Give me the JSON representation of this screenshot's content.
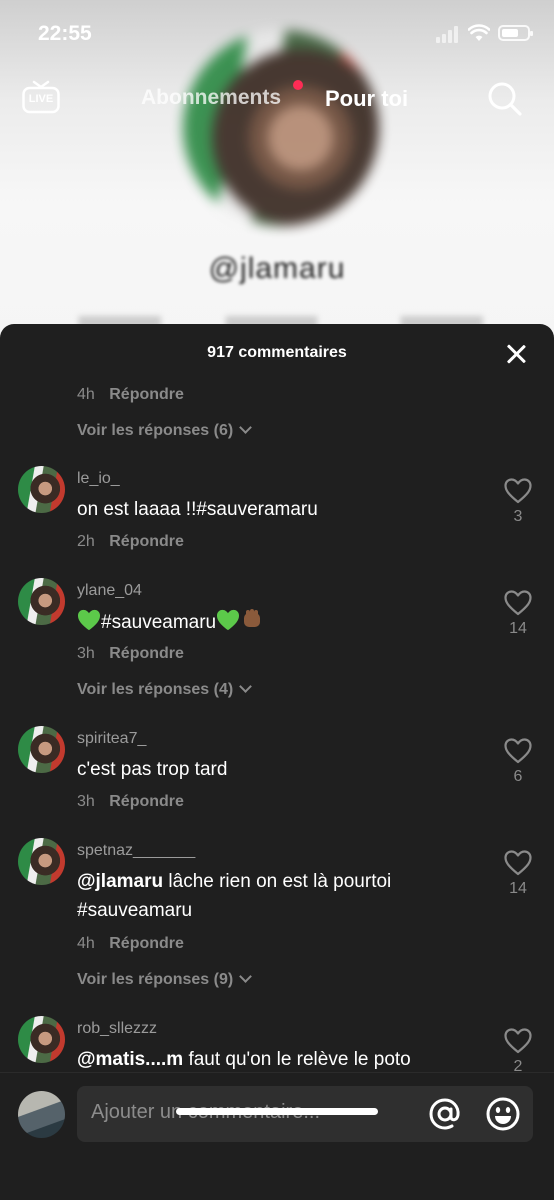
{
  "status_bar": {
    "time": "22:55"
  },
  "nav": {
    "live_label": "LIVE",
    "tab_following": "Abonnements",
    "tab_foryou": "Pour toi"
  },
  "background": {
    "profile_name": "@jlamaru"
  },
  "sheet": {
    "title": "917 commentaires",
    "top_meta": {
      "when": "4h",
      "reply": "Répondre"
    },
    "top_replies": "Voir les réponses (6)"
  },
  "comments": [
    {
      "user": "le_io_",
      "text": "on est laaaa !!#sauveramaru",
      "when": "2h",
      "reply": "Répondre",
      "likes": "3"
    },
    {
      "user": "ylane_04",
      "text": "#sauveamaru",
      "when": "3h",
      "reply": "Répondre",
      "likes": "14",
      "replies": "Voir les réponses (4)"
    },
    {
      "user": "spiritea7_",
      "text": "c'est pas trop tard",
      "when": "3h",
      "reply": "Répondre",
      "likes": "6"
    },
    {
      "user": "spetnaz_______",
      "mention": "@jlamaru",
      "text": " lâche rien on est là pourtoi #sauveamaru",
      "when": "4h",
      "reply": "Répondre",
      "likes": "14",
      "replies": "Voir les réponses (9)"
    },
    {
      "user": "rob_sllezzz",
      "mention": "@matis....m",
      "text": " faut qu'on le relève le poto",
      "likes": "2"
    }
  ],
  "input": {
    "placeholder": "Ajouter un commentaire..."
  },
  "colors": {
    "sheet_bg": "#1f1f1f",
    "accent": "#fe2c55",
    "muted": "#8a8a8a"
  },
  "icons": [
    "live-icon",
    "search-icon",
    "close-icon",
    "heart-icon",
    "at-icon",
    "emoji-icon"
  ]
}
